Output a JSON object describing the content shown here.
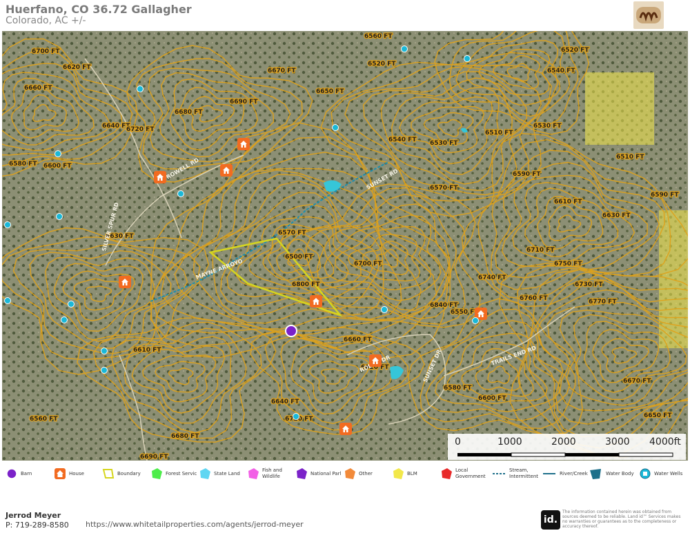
{
  "header": {
    "title": "Huerfano, CO 36.72 Gallagher",
    "subtitle": "Colorado,  AC +/-"
  },
  "map": {
    "contour_labels": [
      "6700 FT",
      "6660 FT",
      "6620 FT",
      "6580 FT",
      "6600 FT",
      "6640 FT",
      "6720 FT",
      "6680 FT",
      "6690 FT",
      "6670 FT",
      "6650 FT",
      "6560 FT",
      "6520 FT",
      "6540 FT",
      "6530 FT",
      "6510 FT",
      "6590 FT",
      "6570 FT",
      "6610 FT",
      "6630 FT",
      "6710 FT",
      "6750 FT",
      "6740 FT",
      "6760 FT",
      "6730 FT",
      "6770 FT",
      "6840 FT",
      "6550 FT",
      "6500 FT",
      "6800 FT"
    ],
    "road_labels": [
      "ROWELL RD",
      "MAYNE ARROYO",
      "RODEO DR",
      "SUNSET DR",
      "TRAILS END RD",
      "SILVER SPUR RD",
      "SUNSET RD"
    ],
    "house_count": 8,
    "barn_count": 1,
    "colors": {
      "contour": "#e0a21a",
      "boundary": "#d6d61e",
      "house": "#f26b21",
      "barn": "#7b22c9",
      "water": "#1ab8d8",
      "blm": "#f2e84a"
    }
  },
  "scale": {
    "ticks": [
      "0",
      "1000",
      "2000",
      "3000",
      "4000ft"
    ]
  },
  "legend": [
    {
      "label": "Barn",
      "icon": "barn-icon",
      "color": "#7b22c9"
    },
    {
      "label": "House",
      "icon": "house-icon",
      "color": "#f26b21"
    },
    {
      "label": "Boundary",
      "icon": "boundary-icon",
      "color": "#d6d61e"
    },
    {
      "label": "Forest Servic",
      "icon": "polygon-icon",
      "color": "#4ded4a"
    },
    {
      "label": "State Land",
      "icon": "polygon-icon",
      "color": "#5fd6f2"
    },
    {
      "label": "Fish and Wildlife",
      "icon": "polygon-icon",
      "color": "#f25fe6"
    },
    {
      "label": "National Parl",
      "icon": "polygon-icon",
      "color": "#7b22c9"
    },
    {
      "label": "Other",
      "icon": "polygon-icon",
      "color": "#f28a3a"
    },
    {
      "label": "BLM",
      "icon": "polygon-icon",
      "color": "#f2e84a"
    },
    {
      "label": "Local Government",
      "icon": "polygon-icon",
      "color": "#e82a2a"
    },
    {
      "label": "Stream, Intermittent",
      "icon": "stream-icon",
      "color": "#1c6f8a"
    },
    {
      "label": "River/Creek",
      "icon": "river-icon",
      "color": "#1c6f8a"
    },
    {
      "label": "Water Body",
      "icon": "waterbody-icon",
      "color": "#1c6f8a"
    },
    {
      "label": "Water Wells",
      "icon": "water-well-icon",
      "color": "#1ab8d8"
    }
  ],
  "footer": {
    "agent_name": "Jerrod Meyer",
    "phone": "P: 719-289-8580",
    "url": "https://www.whitetailproperties.com/agents/jerrod-meyer",
    "id_logo": "id.",
    "disclaimer": "The information contained herein was obtained from sources deemed to be reliable. Land id™ Services makes no warranties or guarantees as to the completeness or accuracy thereof."
  }
}
